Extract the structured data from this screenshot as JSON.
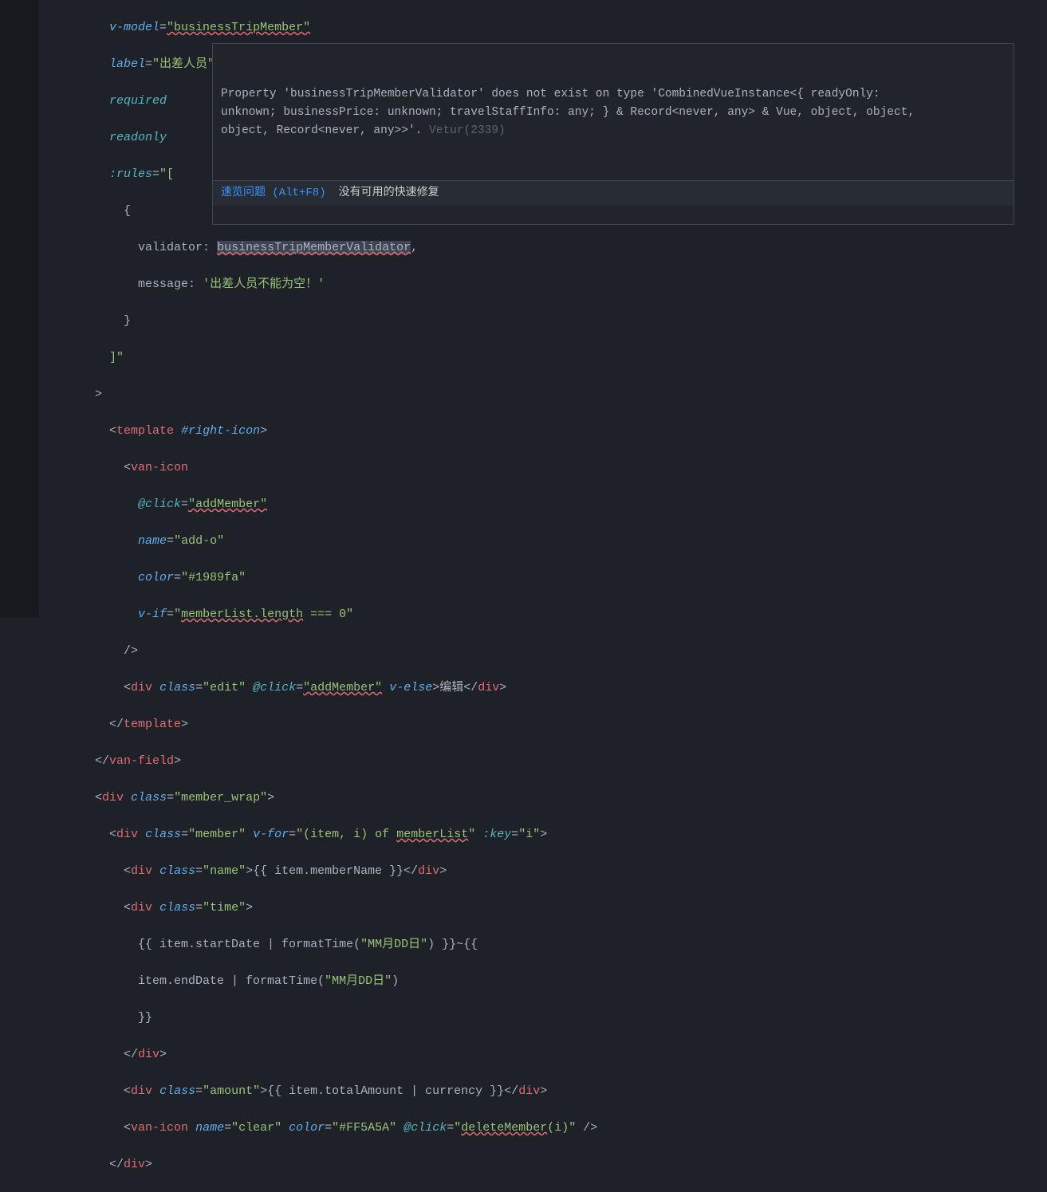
{
  "tooltip": {
    "line1": "Property 'businessTripMemberValidator' does not exist on type 'CombinedVueInstance<{ readyOnly:",
    "line2": "unknown; businessPrice: unknown; travelStaffInfo: any; } & Record<never, any> & Vue, object, object,",
    "line3": "object, Record<never, any>>'.",
    "code": "Vetur(2339)",
    "peek": "速览问题 (Alt+F8)",
    "nofix": "没有可用的快速修复"
  },
  "code": {
    "vmodel_attr": "v-model",
    "vmodel_val": "\"businessTripMember\"",
    "label_attr": "label",
    "label_val": "\"出差人员\"",
    "required": "required",
    "readonly": "readonly",
    "rules_attr": ":rules",
    "rules_open": "\"[",
    "brace_open": "{",
    "validator_key": "validator",
    "validator_val": "businessTripMemberValidator",
    "message_key": "message",
    "message_val": "'出差人员不能为空！'",
    "brace_close": "}",
    "rules_close": "]\"",
    "gt": ">",
    "template_open": "template",
    "slot_right_icon": "#right-icon",
    "van_icon": "van-icon",
    "at_click": "@click",
    "addMember": "\"addMember\"",
    "name_attr": "name",
    "addo": "\"add-o\"",
    "color_attr": "color",
    "color1": "\"#1989fa\"",
    "vif": "v-if",
    "vif_val": "\"memberList.length === 0\"",
    "slash_close": "/>",
    "div": "div",
    "class_attr": "class",
    "edit": "\"edit\"",
    "velse": "v-else",
    "edit_text": "编辑",
    "template_close": "template",
    "van_field": "van-field",
    "member_wrap": "\"member_wrap\"",
    "member": "\"member\"",
    "vfor": "v-for",
    "vfor_val": "\"(item, i) of memberList\"",
    "key": ":key",
    "key_val": "\"i\"",
    "name_cls": "\"name\"",
    "mustache_memberName": "{{ item.memberName }}",
    "time_cls": "\"time\"",
    "time_l1": "{{ item.startDate | formatTime(\"MM月DD日\") }}~{{",
    "time_l2": "item.endDate | formatTime(\"MM月DD日\")",
    "time_l3": "}}",
    "amount_cls": "\"amount\"",
    "mustache_amount": "{{ item.totalAmount | currency }}",
    "clear": "\"clear\"",
    "color2": "\"#FF5A5A\"",
    "deleteMember": "\"deleteMember(i)\""
  }
}
